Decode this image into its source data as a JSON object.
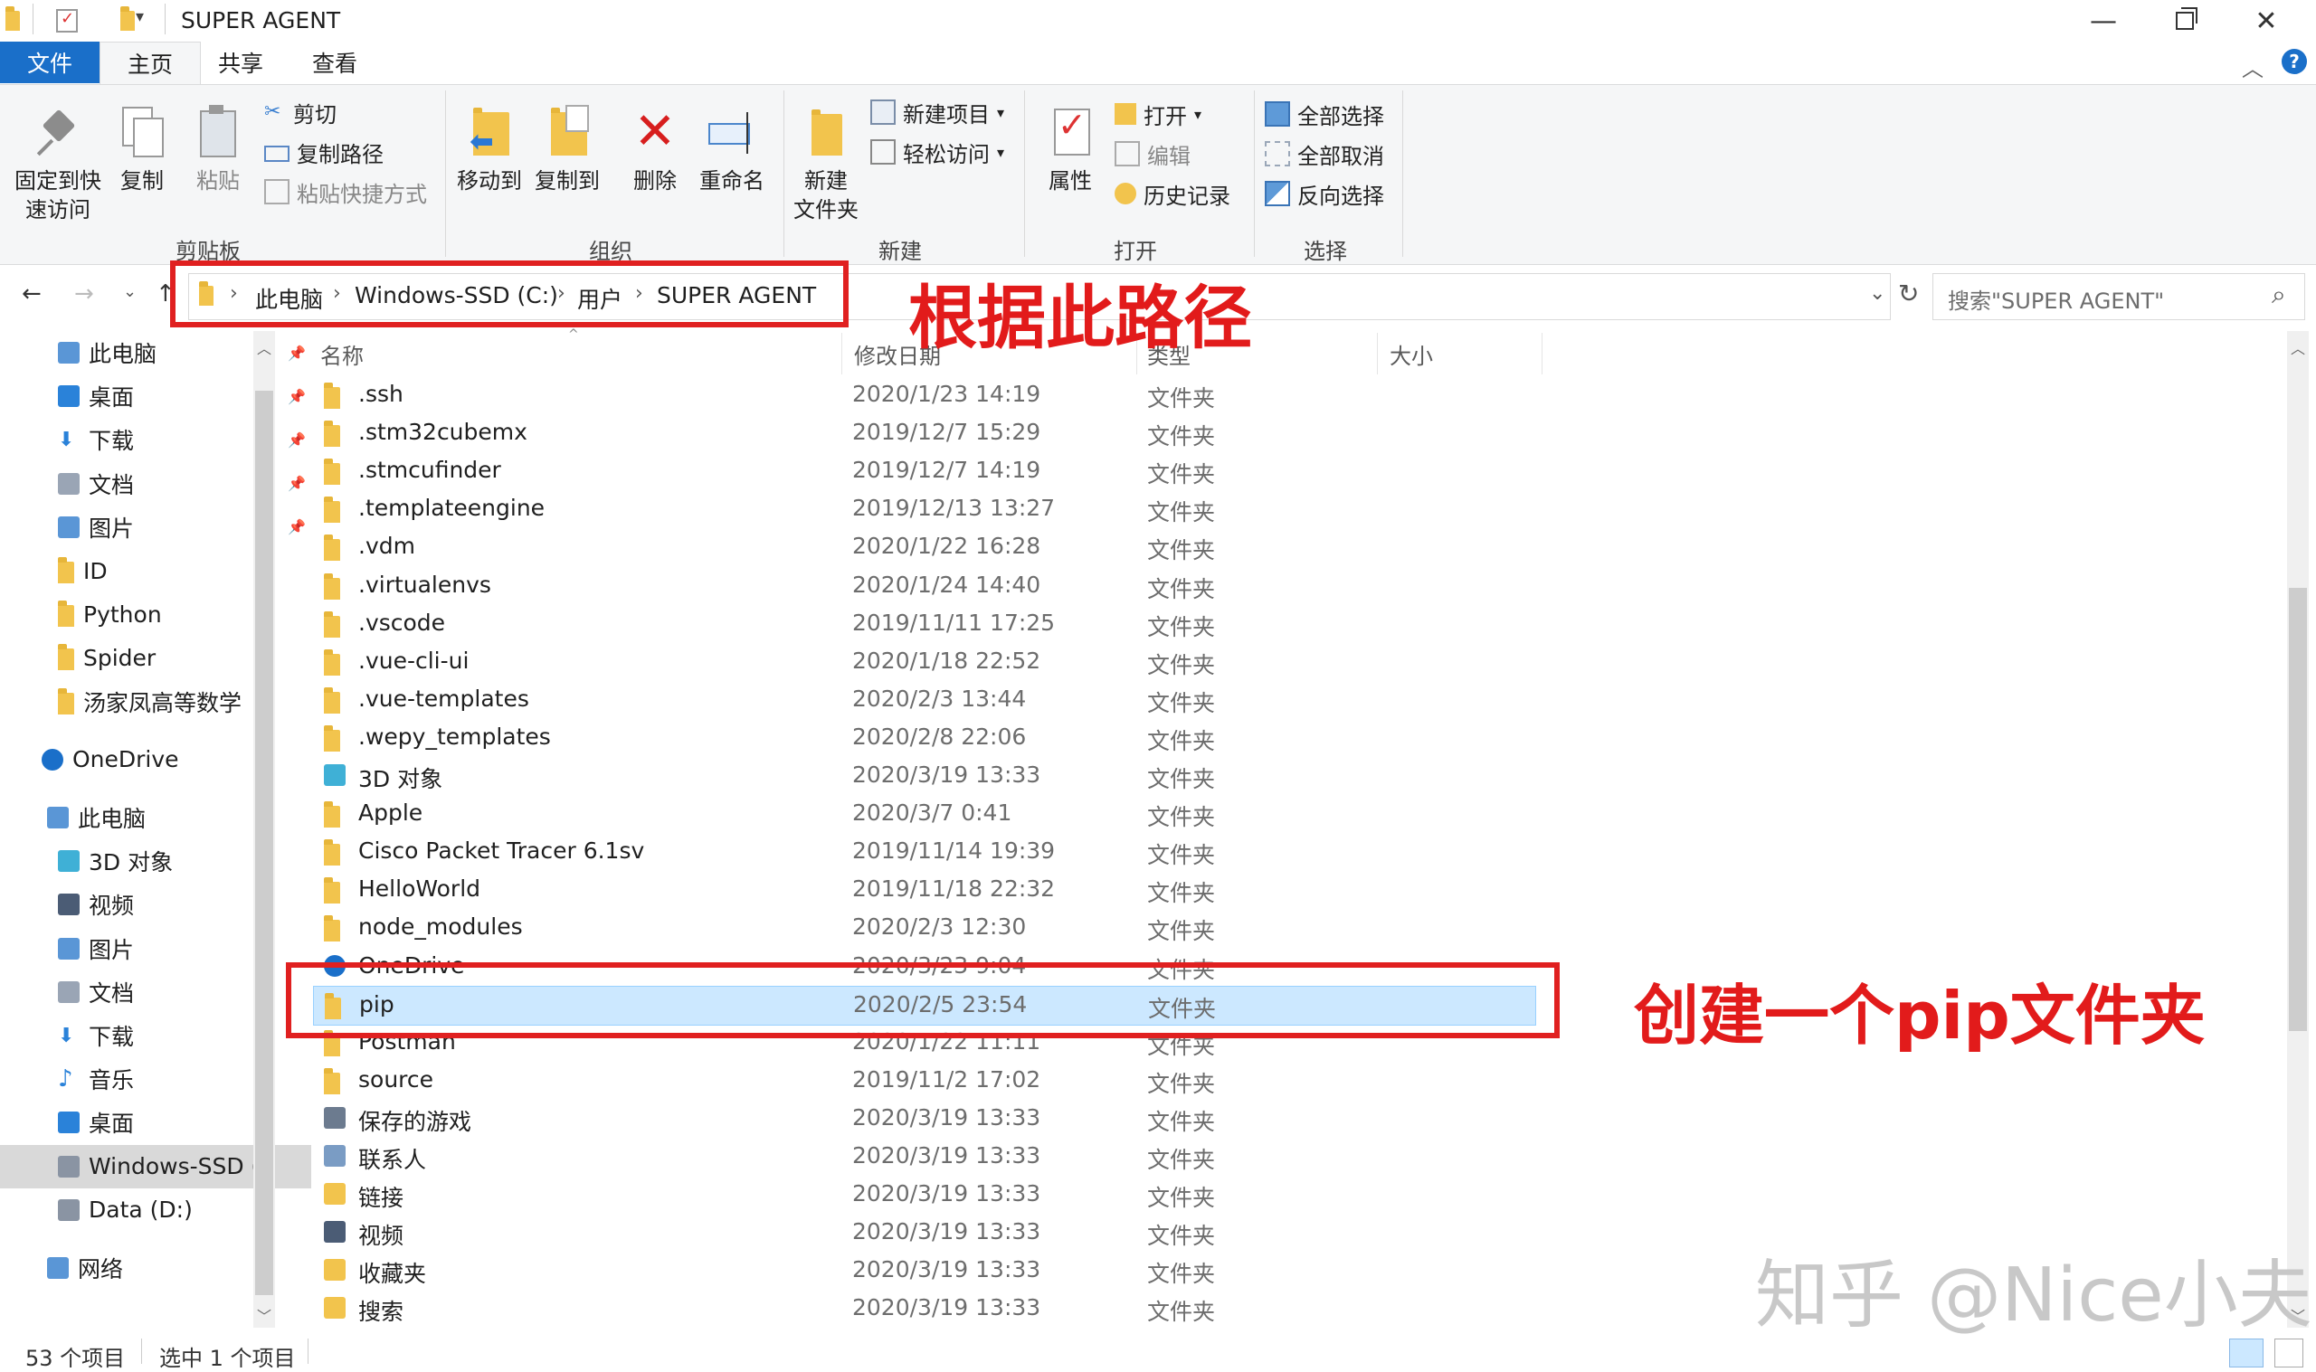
{
  "window": {
    "title": "SUPER AGENT"
  },
  "ribbon_tabs": [
    "文件",
    "主页",
    "共享",
    "查看"
  ],
  "ribbon": {
    "clipboard": {
      "label": "剪贴板",
      "pin": "固定到快速访问",
      "pin_line1": "固定到快",
      "pin_line2": "速访问",
      "copy": "复制",
      "paste": "粘贴",
      "cut": "剪切",
      "copy_path": "复制路径",
      "paste_shortcut": "粘贴快捷方式"
    },
    "organize": {
      "label": "组织",
      "move_to": "移动到",
      "copy_to": "复制到",
      "delete": "删除",
      "rename": "重命名"
    },
    "new": {
      "label": "新建",
      "new_folder_line1": "新建",
      "new_folder_line2": "文件夹",
      "new_item": "新建项目",
      "easy_access": "轻松访问"
    },
    "open": {
      "label": "打开",
      "properties": "属性",
      "open": "打开",
      "edit": "编辑",
      "history": "历史记录"
    },
    "select": {
      "label": "选择",
      "select_all": "全部选择",
      "select_none": "全部取消",
      "invert": "反向选择"
    }
  },
  "address": {
    "crumbs": [
      "此电脑",
      "Windows-SSD (C:)",
      "用户",
      "SUPER AGENT"
    ],
    "search_placeholder": "搜索\"SUPER AGENT\""
  },
  "nav": {
    "quick": [
      {
        "label": "此电脑",
        "icon": "computer-icon",
        "pinned": true
      },
      {
        "label": "桌面",
        "icon": "desktop-icon",
        "pinned": true
      },
      {
        "label": "下载",
        "icon": "download-icon",
        "pinned": true
      },
      {
        "label": "文档",
        "icon": "document-icon",
        "pinned": true
      },
      {
        "label": "图片",
        "icon": "pictures-icon",
        "pinned": true
      },
      {
        "label": "ID",
        "icon": "folder-icon",
        "pinned": false
      },
      {
        "label": "Python",
        "icon": "folder-icon",
        "pinned": false
      },
      {
        "label": "Spider",
        "icon": "folder-icon",
        "pinned": false
      },
      {
        "label": "汤家凤高等数学",
        "icon": "folder-icon",
        "pinned": false
      }
    ],
    "onedrive": "OneDrive",
    "pc": "此电脑",
    "pc_items": [
      {
        "label": "3D 对象",
        "icon": "3d-objects-icon"
      },
      {
        "label": "视频",
        "icon": "video-icon"
      },
      {
        "label": "图片",
        "icon": "pictures-icon"
      },
      {
        "label": "文档",
        "icon": "document-icon"
      },
      {
        "label": "下载",
        "icon": "download-icon"
      },
      {
        "label": "音乐",
        "icon": "music-icon"
      },
      {
        "label": "桌面",
        "icon": "desktop-icon"
      },
      {
        "label": "Windows-SSD (",
        "icon": "drive-icon"
      },
      {
        "label": "Data (D:)",
        "icon": "drive-icon"
      }
    ],
    "network": "网络"
  },
  "columns": {
    "name": "名称",
    "date": "修改日期",
    "type": "类型",
    "size": "大小"
  },
  "files": [
    {
      "name": ".ssh",
      "date": "2020/1/23 14:19",
      "type": "文件夹",
      "icon": "folder-icon"
    },
    {
      "name": ".stm32cubemx",
      "date": "2019/12/7 15:29",
      "type": "文件夹",
      "icon": "folder-icon"
    },
    {
      "name": ".stmcufinder",
      "date": "2019/12/7 14:19",
      "type": "文件夹",
      "icon": "folder-icon"
    },
    {
      "name": ".templateengine",
      "date": "2019/12/13 13:27",
      "type": "文件夹",
      "icon": "folder-icon"
    },
    {
      "name": ".vdm",
      "date": "2020/1/22 16:28",
      "type": "文件夹",
      "icon": "folder-icon"
    },
    {
      "name": ".virtualenvs",
      "date": "2020/1/24 14:40",
      "type": "文件夹",
      "icon": "folder-icon"
    },
    {
      "name": ".vscode",
      "date": "2019/11/11 17:25",
      "type": "文件夹",
      "icon": "folder-icon"
    },
    {
      "name": ".vue-cli-ui",
      "date": "2020/1/18 22:52",
      "type": "文件夹",
      "icon": "folder-icon"
    },
    {
      "name": ".vue-templates",
      "date": "2020/2/3 13:44",
      "type": "文件夹",
      "icon": "folder-icon"
    },
    {
      "name": ".wepy_templates",
      "date": "2020/2/8 22:06",
      "type": "文件夹",
      "icon": "folder-icon"
    },
    {
      "name": "3D 对象",
      "date": "2020/3/19 13:33",
      "type": "文件夹",
      "icon": "3d-objects-icon"
    },
    {
      "name": "Apple",
      "date": "2020/3/7 0:41",
      "type": "文件夹",
      "icon": "folder-icon"
    },
    {
      "name": "Cisco Packet Tracer 6.1sv",
      "date": "2019/11/14 19:39",
      "type": "文件夹",
      "icon": "folder-icon"
    },
    {
      "name": "HelloWorld",
      "date": "2019/11/18 22:32",
      "type": "文件夹",
      "icon": "folder-icon"
    },
    {
      "name": "node_modules",
      "date": "2020/2/3 12:30",
      "type": "文件夹",
      "icon": "folder-icon"
    },
    {
      "name": "OneDrive",
      "date": "2020/3/23 9:04",
      "type": "文件夹",
      "icon": "onedrive-icon"
    },
    {
      "name": "pip",
      "date": "2020/2/5 23:54",
      "type": "文件夹",
      "icon": "folder-icon",
      "selected": true
    },
    {
      "name": "Postman",
      "date": "2020/1/22 11:11",
      "type": "文件夹",
      "icon": "folder-icon"
    },
    {
      "name": "source",
      "date": "2019/11/2 17:02",
      "type": "文件夹",
      "icon": "folder-icon"
    },
    {
      "name": "保存的游戏",
      "date": "2020/3/19 13:33",
      "type": "文件夹",
      "icon": "saved-games-icon"
    },
    {
      "name": "联系人",
      "date": "2020/3/19 13:33",
      "type": "文件夹",
      "icon": "contacts-icon"
    },
    {
      "name": "链接",
      "date": "2020/3/19 13:33",
      "type": "文件夹",
      "icon": "links-icon"
    },
    {
      "name": "视频",
      "date": "2020/3/19 13:33",
      "type": "文件夹",
      "icon": "video-icon"
    },
    {
      "name": "收藏夹",
      "date": "2020/3/19 13:33",
      "type": "文件夹",
      "icon": "favorites-icon"
    },
    {
      "name": "搜索",
      "date": "2020/3/19 13:33",
      "type": "文件夹",
      "icon": "search-folder-icon"
    }
  ],
  "status": {
    "count": "53 个项目",
    "selected": "选中 1 个项目"
  },
  "annotations": {
    "path_note": "根据此路径",
    "pip_note": "创建一个pip文件夹"
  },
  "watermark": "知乎 @Nice小夫",
  "colors": {
    "accent": "#1a6fc9",
    "selection": "#cce8ff",
    "annotation_red": "#e02020",
    "folder": "#f2c44d"
  }
}
